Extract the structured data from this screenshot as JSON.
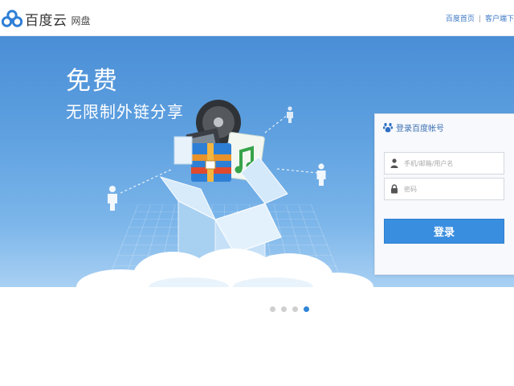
{
  "header": {
    "logo_text": "百度云",
    "logo_sub": "网盘",
    "links": [
      "百度首页",
      "客户端下"
    ]
  },
  "banner": {
    "title": "免费",
    "subtitle": "无限制外链分享"
  },
  "login": {
    "title": "登录百度帐号",
    "username_placeholder": "手机/邮箱/用户名",
    "password_placeholder": "密码",
    "submit_label": "登录"
  },
  "carousel": {
    "total": 4,
    "active_index": 3
  },
  "colors": {
    "banner_top": "#4a8ed6",
    "banner_bottom": "#a9d0f3",
    "button": "#3a8ee0",
    "link": "#3c78c6",
    "dot_active": "#2f84d6"
  },
  "icons": {
    "logo": "baidu-cloud-logo-icon",
    "login_logo": "baidu-paw-icon",
    "user": "user-icon",
    "password": "lock-icon"
  }
}
